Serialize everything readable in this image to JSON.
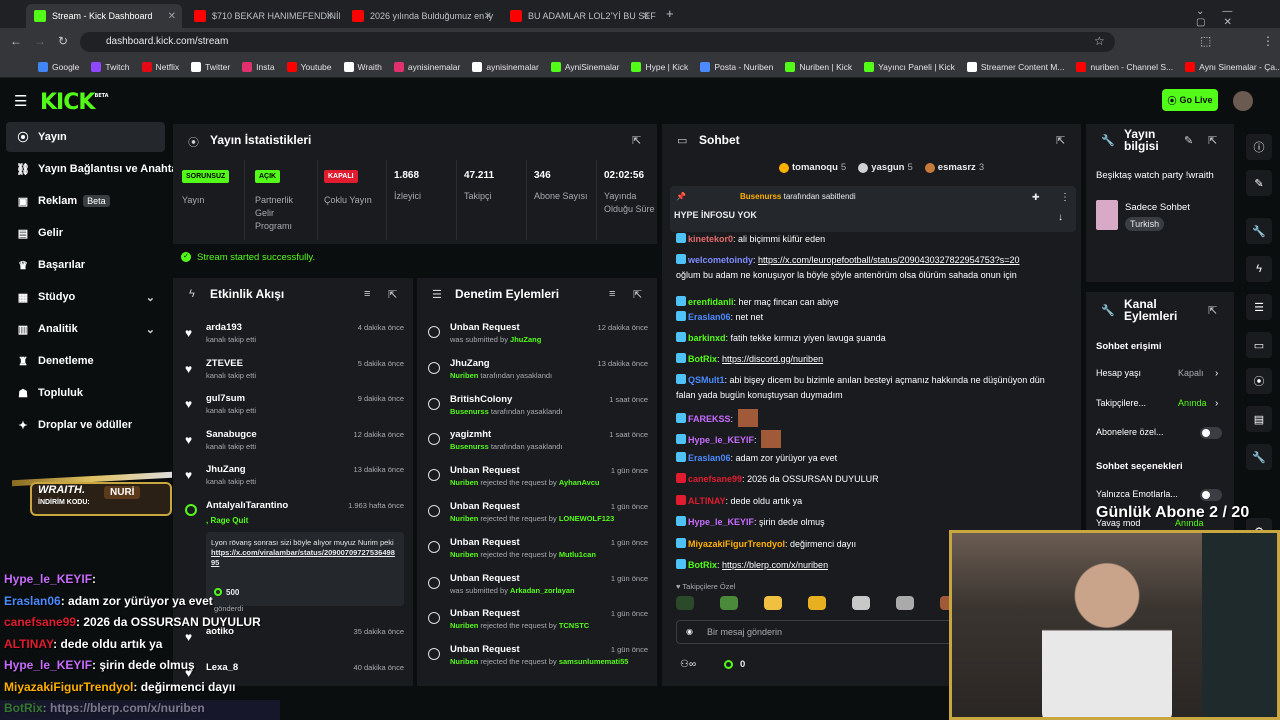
{
  "browser": {
    "tabs": [
      {
        "title": "Stream - Kick Dashboard",
        "color": "#53fc18"
      },
      {
        "title": "$710 BEKAR HANIMEFENDİNİN",
        "color": "#ff0000"
      },
      {
        "title": "2026 yılında Bulduğumuz en iy",
        "color": "#ff0000"
      },
      {
        "title": "BU ADAMLAR LOL2'Yİ BU SEFER",
        "color": "#ff0000"
      }
    ],
    "new_tab": "+",
    "url": "dashboard.kick.com/stream",
    "bookmarks": [
      "Google",
      "Twitch",
      "Netflix",
      "Twitter",
      "Insta",
      "Youtube",
      "Wraith",
      "aynisinemalar",
      "aynisinemalar",
      "AyniSinemalar",
      "Hype | Kick",
      "Posta - Nuriben",
      "Nuriben | Kick",
      "Yayıncı Paneli | Kick",
      "Streamer Content M...",
      "nuriben - Channel S...",
      "Aynı Sinemalar - Ça..."
    ]
  },
  "header": {
    "logo": "KICK",
    "beta": "BETA",
    "go_live": "Go Live"
  },
  "sidebar": [
    {
      "label": "Yayın",
      "icon": "broadcast-icon"
    },
    {
      "label": "Yayın Bağlantısı ve Anahtarı",
      "icon": "link-icon"
    },
    {
      "label": "Reklam",
      "icon": "ad-icon",
      "badge": "Beta"
    },
    {
      "label": "Gelir",
      "icon": "revenue-icon"
    },
    {
      "label": "Başarılar",
      "icon": "trophy-icon"
    },
    {
      "label": "Stüdyo",
      "icon": "studio-icon"
    },
    {
      "label": "Analitik",
      "icon": "analytics-icon"
    },
    {
      "label": "Denetleme",
      "icon": "moderation-icon"
    },
    {
      "label": "Topluluk",
      "icon": "community-icon"
    },
    {
      "label": "Droplar ve ödüller",
      "icon": "gift-icon"
    }
  ],
  "stats": {
    "title": "Yayın İstatistikleri",
    "items": [
      {
        "tag": "SORUNSUZ",
        "label": "Yayın",
        "tag_color": "#53fc18"
      },
      {
        "tag": "AÇIK",
        "label": "Partnerlik Gelir Programı",
        "tag_color": "#53fc18"
      },
      {
        "tag": "KAPALI",
        "label": "Çoklu Yayın",
        "tag_color": "#e01c2e"
      },
      {
        "value": "1.868",
        "label": "İzleyici"
      },
      {
        "value": "47.211",
        "label": "Takipçi"
      },
      {
        "value": "346",
        "label": "Abone Sayısı"
      },
      {
        "value": "02:02:56",
        "label": "Yayında Olduğu Süre"
      }
    ],
    "status": "Stream started successfully."
  },
  "activity": {
    "title": "Etkinlik Akışı",
    "items": [
      {
        "name": "arda193",
        "sub": "kanalı takip etti",
        "time": "4 dakika önce"
      },
      {
        "name": "ZTEVEE",
        "sub": "kanalı takip etti",
        "time": "5 dakika önce"
      },
      {
        "name": "gul7sum",
        "sub": "kanalı takip etti",
        "time": "9 dakika önce"
      },
      {
        "name": "Sanabugce",
        "sub": "kanalı takip etti",
        "time": "12 dakika önce"
      },
      {
        "name": "JhuZang",
        "sub": "kanalı takip etti",
        "time": "13 dakika önce"
      }
    ],
    "bet": {
      "name": "AntalyalıTarantino",
      "sub": "Rage Quit",
      "time": "1.963 hafta önce",
      "msg": "Lyon rövanş sonrası sizi böyle alıyor muyuz Nurim peki",
      "link": "https://x.com/viralambar/status/2090070972753649895",
      "amount": "500",
      "sent": "gönderdi"
    },
    "more": [
      {
        "name": "aotiko",
        "time": "35 dakika önce"
      },
      {
        "name": "Lexa_8",
        "time": "40 dakika önce"
      }
    ]
  },
  "moderation": {
    "title": "Denetim Eylemleri",
    "items": [
      {
        "name": "Unban Request",
        "pre": "was submitted by",
        "who": "JhuZang",
        "post": "",
        "time": "12 dakika önce",
        "kind": "undo"
      },
      {
        "name": "JhuZang",
        "pre": "",
        "who": "Nuriben",
        "post": "tarafından yasaklandı",
        "time": "13 dakika önce",
        "kind": "ban"
      },
      {
        "name": "BritishColony",
        "pre": "",
        "who": "Busenurss",
        "post": "tarafından yasaklandı",
        "time": "1 saat önce",
        "kind": "ban"
      },
      {
        "name": "yagizmht",
        "pre": "",
        "who": "Busenurss",
        "post": "tarafından yasaklandı",
        "time": "1 saat önce",
        "kind": "ban"
      },
      {
        "name": "Unban Request",
        "pre": "",
        "who": "Nuriben",
        "post": "rejected the request by",
        "who2": "AyhanAvcu",
        "time": "1 gün önce",
        "kind": "undo"
      },
      {
        "name": "Unban Request",
        "pre": "",
        "who": "Nuriben",
        "post": "rejected the request by",
        "who2": "LONEWOLF123",
        "time": "1 gün önce",
        "kind": "undo"
      },
      {
        "name": "Unban Request",
        "pre": "",
        "who": "Nuriben",
        "post": "rejected the request by",
        "who2": "Mutlu1can",
        "time": "1 gün önce",
        "kind": "undo"
      },
      {
        "name": "Unban Request",
        "pre": "was submitted by",
        "who": "Arkadan_zorlayan",
        "post": "",
        "time": "1 gün önce",
        "kind": "undo"
      },
      {
        "name": "Unban Request",
        "pre": "",
        "who": "Nuriben",
        "post": "rejected the request by",
        "who2": "TCNSTC",
        "time": "1 gün önce",
        "kind": "undo"
      },
      {
        "name": "Unban Request",
        "pre": "",
        "who": "Nuriben",
        "post": "rejected the request by",
        "who2": "samsunlumemati55",
        "time": "1 gün önce",
        "kind": "undo"
      }
    ]
  },
  "chat": {
    "title": "Sohbet",
    "top": [
      {
        "name": "tomanoqu",
        "n": "5"
      },
      {
        "name": "yasgun",
        "n": "5"
      },
      {
        "name": "esmasrz",
        "n": "3"
      }
    ],
    "pinned_by": "Busenurss",
    "pinned_suffix": "tarafından sabitlendi",
    "pinned_msg": "HYPE İNFOSU YOK",
    "messages": [
      {
        "user": "kinetekor0",
        "color": "#e36b6b",
        "text": "ali biçimmi küfür eden"
      },
      {
        "user": "welcometoindy",
        "color": "#7f8cff",
        "text": "",
        "link": "https://x.com/leuropefootball/status/2090430327822954753?s=20",
        "text2": "oğlum bu adam ne konuşuyor la böyle şöyle antenörüm olsa ölürüm sahada onun için"
      },
      {
        "user": "erenfidanli",
        "color": "#53fc18",
        "text": "her maç fincan can abiye"
      },
      {
        "user": "Eraslan06",
        "color": "#4b8bff",
        "text": "net net"
      },
      {
        "user": "barkinxd",
        "color": "#53fc18",
        "text": "fatih tekke kırmızı yiyen lavuga şuanda"
      },
      {
        "user": "BotRix",
        "color": "#53fc18",
        "text": "",
        "link": "https://discord.gg/nuriben"
      },
      {
        "user": "QSMult1",
        "color": "#4b8bff",
        "text": "abi bişey dicem bu bizimle anılan besteyi açmanız hakkında ne düşünüyon dün falan yada bugün konuştuysan duymadım"
      },
      {
        "user": "FAREKSS",
        "color": "#c86bff",
        "text": ""
      },
      {
        "user": "Hype_le_KEYIF",
        "color": "#c86bff",
        "text": ""
      },
      {
        "user": "Eraslan06",
        "color": "#4b8bff",
        "text": "adam zor yürüyor ya evet"
      },
      {
        "user": "canefsane99",
        "color": "#e01c2e",
        "text": "2026 da OSSURSAN DUYULUR"
      },
      {
        "user": "ALTINAY",
        "color": "#e01c2e",
        "text": "dede oldu artık ya"
      },
      {
        "user": "Hype_le_KEYIF",
        "color": "#c86bff",
        "text": "şirin dede olmuş"
      },
      {
        "user": "MiyazakiFigurTrendyol",
        "color": "#ffb000",
        "text": "değirmenci dayıı"
      },
      {
        "user": "BotRix",
        "color": "#53fc18",
        "text": "",
        "link": "https://blerp.com/x/nuriben"
      }
    ],
    "emotes_label": "Takipçilere Özel",
    "placeholder": "Bir mesaj gönderin",
    "footer_count": "0"
  },
  "info": {
    "title": "Yayın bilgisi",
    "stream_title": "Beşiktaş watch party !wraith",
    "category": "Sadece Sohbet",
    "language": "Turkish"
  },
  "channel": {
    "title": "Kanal Eylemleri",
    "access": "Sohbet erişimi",
    "rows": [
      {
        "label": "Hesap yaşı",
        "value": "Kapalı",
        "value_color": "#a8abaf"
      },
      {
        "label": "Takipçilere...",
        "value": "Anında",
        "value_color": "#53fc18"
      },
      {
        "label": "Abonelere özel...",
        "value": ""
      }
    ],
    "options": "Sohbet seçenekleri",
    "emote": "Yalnızca Emotlarla...",
    "slow": "Yavaş mod",
    "slow_value": "Anında"
  },
  "overlay": {
    "sub_goal": "Günlük Abone 2 / 20",
    "promo_title": "WRAITH.",
    "promo_sub": "İNDİRİM KODU:",
    "promo_code": "NURİ",
    "lines": [
      {
        "user": "Hype_le_KEYIF",
        "color": "#c86bff",
        "text": ": "
      },
      {
        "user": "Eraslan06",
        "color": "#4b8bff",
        "text": ": adam zor yürüyor ya evet"
      },
      {
        "user": "canefsane99",
        "color": "#e01c2e",
        "text": ": 2026 da OSSURSAN DUYULUR"
      },
      {
        "user": "ALTINAY",
        "color": "#e01c2e",
        "text": ": dede oldu artık ya"
      },
      {
        "user": "Hype_le_KEYIF",
        "color": "#c86bff",
        "text": ": şirin dede olmuş"
      },
      {
        "user": "MiyazakiFigurTrendyol",
        "color": "#ffb000",
        "text": ": değirmenci dayıı"
      },
      {
        "user": "BotRix",
        "color": "#53fc18",
        "text": ": https://blerp.com/x/nuriben"
      }
    ]
  }
}
